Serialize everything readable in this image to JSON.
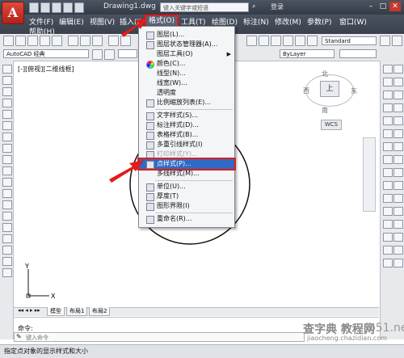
{
  "title_bar": {
    "app_letter": "A",
    "doc_title": "Drawing1.dwg",
    "search_placeholder": "键入关键字或短语",
    "login": "登录"
  },
  "menu": {
    "items": [
      "文件(F)",
      "编辑(E)",
      "视图(V)",
      "插入(I)",
      "格式(O)",
      "工具(T)",
      "绘图(D)",
      "标注(N)",
      "修改(M)",
      "参数(P)",
      "窗口(W)"
    ],
    "help": "帮助(H)"
  },
  "toolbar": {
    "workspace": "AutoCAD 经典",
    "style": "Standard",
    "layer_color": "ByLayer"
  },
  "viewport": {
    "label": "[-][俯视][二维线框]",
    "cube_north": "北",
    "cube_south": "南",
    "cube_west": "西",
    "cube_east": "东",
    "cube_top": "上",
    "wcs": "WCS"
  },
  "tabs": [
    "模型",
    "布局1",
    "布局2"
  ],
  "command": {
    "label": "命令:",
    "placeholder": "键入命令"
  },
  "status": "指定点对象的显示样式和大小",
  "format_menu": {
    "items": [
      {
        "label": "图层(L)...",
        "icon": "layer-icon"
      },
      {
        "label": "图层状态管理器(A)...",
        "icon": "layer-state-icon"
      },
      {
        "label": "图层工具(O)",
        "icon": "",
        "submenu": true
      },
      {
        "label": "颜色(C)...",
        "icon": "color-icon"
      },
      {
        "label": "线型(N)...",
        "icon": ""
      },
      {
        "label": "线宽(W)...",
        "icon": ""
      },
      {
        "label": "透明度",
        "icon": ""
      },
      {
        "label": "比例缩放列表(E)...",
        "icon": "scale-list-icon"
      },
      {
        "label": "文字样式(S)...",
        "icon": "text-style-icon"
      },
      {
        "label": "标注样式(D)...",
        "icon": "dim-style-icon"
      },
      {
        "label": "表格样式(B)...",
        "icon": "table-style-icon"
      },
      {
        "label": "多重引线样式(I)",
        "icon": "mleader-style-icon"
      },
      {
        "label": "打印样式(Y)...",
        "icon": "plot-style-icon",
        "disabled": true
      },
      {
        "label": "点样式(P)...",
        "icon": "point-style-icon"
      },
      {
        "label": "多线样式(M)...",
        "icon": ""
      },
      {
        "label": "单位(U)...",
        "icon": "units-icon"
      },
      {
        "label": "厚度(T)",
        "icon": "thickness-icon"
      },
      {
        "label": "图形界限(I)",
        "icon": "limits-icon"
      },
      {
        "label": "重命名(R)...",
        "icon": "rename-icon"
      }
    ]
  },
  "watermark": {
    "line1": "查字典 教程网",
    "line2": "jiaocheng.chazidian.com",
    "site": "jb51.net"
  },
  "colors": {
    "highlight_red": "#e31b1b",
    "menu_selection": "#2f6bc4",
    "title_bar": "#3a414d"
  }
}
